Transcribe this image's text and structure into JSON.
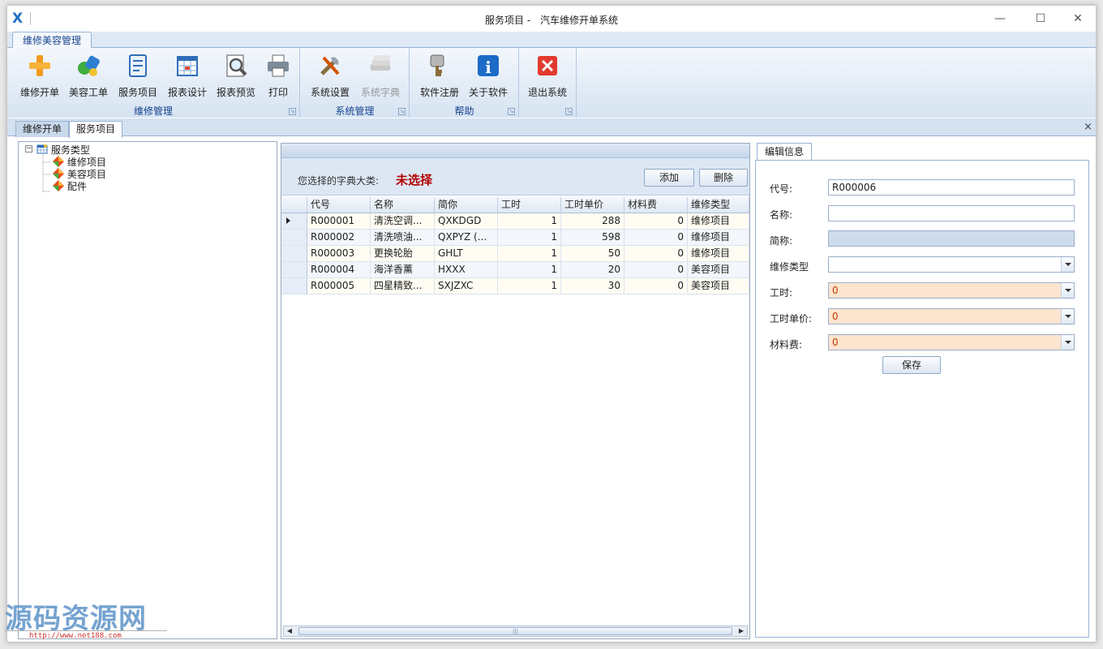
{
  "window": {
    "title_left": "服务项目 -",
    "title_right": "汽车维修开单系统",
    "logo": "X",
    "minimize_icon": "—",
    "maximize_icon": "☐",
    "close_icon": "✕"
  },
  "ribbon": {
    "tab": "维修美容管理",
    "groups": [
      {
        "label": "维修管理",
        "buttons": [
          "维修开单",
          "美容工单",
          "服务项目",
          "报表设计",
          "报表预览",
          "打印"
        ]
      },
      {
        "label": "系统管理",
        "buttons": [
          "系统设置",
          "系统字典"
        ]
      },
      {
        "label": "帮助",
        "buttons": [
          "软件注册",
          "关于软件"
        ]
      },
      {
        "label": "",
        "buttons": [
          "退出系统"
        ]
      }
    ],
    "launcher": "↘"
  },
  "doc_tabs": [
    "维修开单",
    "服务项目"
  ],
  "doc_close": "×",
  "tree": {
    "root": "服务类型",
    "toggle": "−",
    "children": [
      "维修项目",
      "美容项目",
      "配件"
    ]
  },
  "middle": {
    "selected_label": "您选择的字典大类:",
    "selected_value": "未选择",
    "add_button": "添加",
    "delete_button": "删除",
    "columns": [
      "代号",
      "名称",
      "简你",
      "工时",
      "工时单价",
      "材料费",
      "维修类型"
    ],
    "rows": [
      [
        "R000001",
        "清洗空调...",
        "QXKDGD",
        "1",
        "288",
        "0",
        "维修项目"
      ],
      [
        "R000002",
        "清洗喷油...",
        "QXPYZ (...",
        "1",
        "598",
        "0",
        "维修项目"
      ],
      [
        "R000003",
        "更换轮胎",
        "GHLT",
        "1",
        "50",
        "0",
        "维修项目"
      ],
      [
        "R000004",
        "海洋香薰",
        "HXXX",
        "1",
        "20",
        "0",
        "美容项目"
      ],
      [
        "R000005",
        "四星精致...",
        "SXJZXC",
        "1",
        "30",
        "0",
        "美容项目"
      ]
    ],
    "scroll_left": "◀",
    "scroll_right": "▶",
    "scroll_grip": "|||"
  },
  "edit": {
    "tab": "编辑信息",
    "fields": {
      "code_label": "代号:",
      "code_value": "R000006",
      "name_label": "名称:",
      "name_value": "",
      "abbr_label": "简称:",
      "abbr_value": "",
      "type_label": "维修类型",
      "type_value": "",
      "hours_label": "工时:",
      "hours_value": "0",
      "price_label": "工时单价:",
      "price_value": "0",
      "material_label": "材料费:",
      "material_value": "0"
    },
    "save_button": "保存"
  },
  "watermark": {
    "text": "源码资源网",
    "url": "http://www.net188.com"
  },
  "colors": {
    "accent": "#15428b",
    "selected_value": "#b30000",
    "peach_field": "#fde4cf"
  }
}
